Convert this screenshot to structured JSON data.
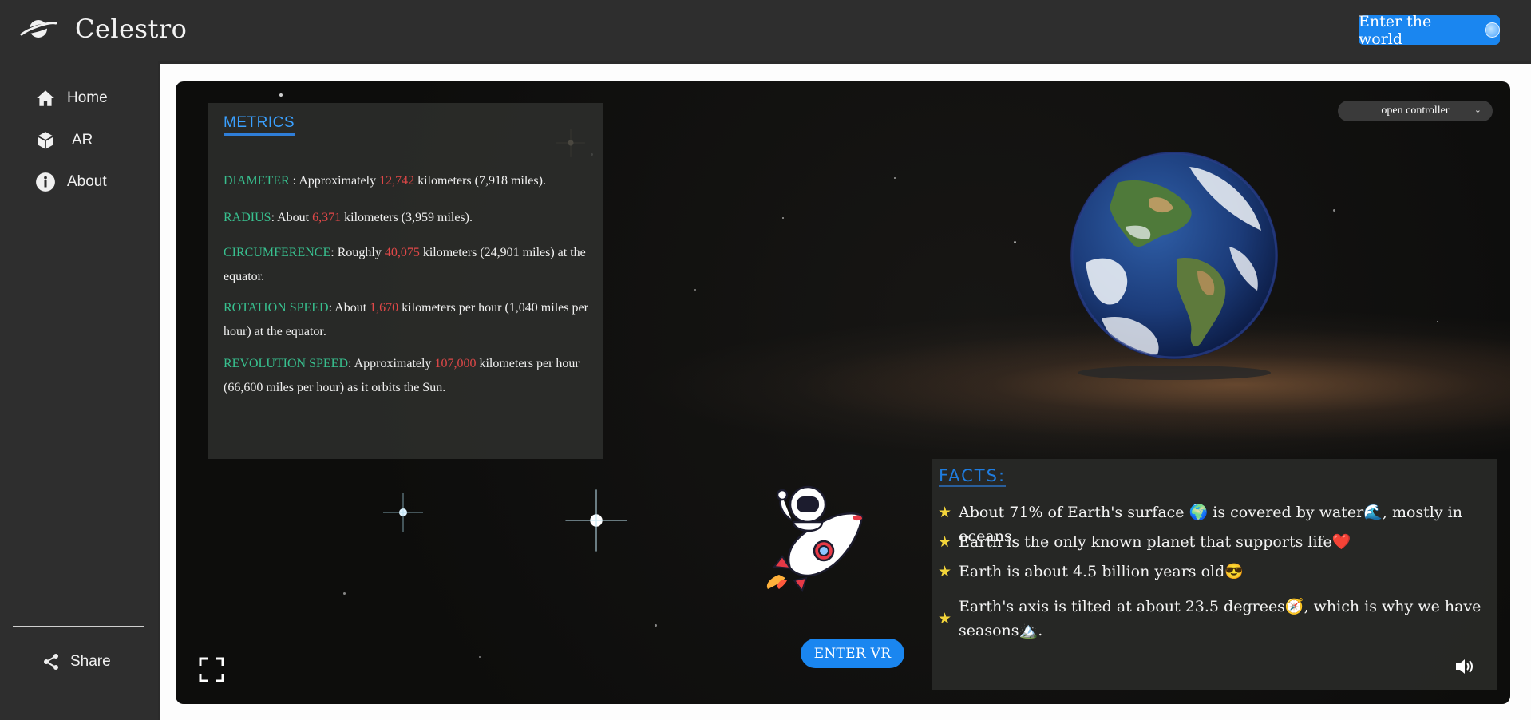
{
  "header": {
    "brand": "Celestro",
    "enter_world_label": "Enter the world"
  },
  "sidebar": {
    "items": [
      {
        "label": "Home",
        "icon": "home-icon"
      },
      {
        "label": "AR",
        "icon": "cube-icon"
      },
      {
        "label": "About",
        "icon": "info-icon"
      }
    ],
    "share_label": "Share"
  },
  "scene": {
    "controller_label": "open controller",
    "enter_vr_label": "ENTER VR"
  },
  "metrics": {
    "title": "METRICS",
    "rows": [
      {
        "key": "DIAMETER",
        "pre": " : Approximately ",
        "num": "12,742",
        "post": " kilometers (7,918 miles)."
      },
      {
        "key": "RADIUS",
        "pre": ": About ",
        "num": "6,371",
        "post": " kilometers (3,959 miles)."
      },
      {
        "key": "CIRCUMFERENCE",
        "pre": ": Roughly ",
        "num": "40,075",
        "post": " kilometers (24,901 miles) at the equator."
      },
      {
        "key": "ROTATION SPEED",
        "pre": ": About ",
        "num": "1,670",
        "post": " kilometers per hour (1,040 miles per hour) at the equator."
      },
      {
        "key": "REVOLUTION SPEED",
        "pre": ":  Approximately ",
        "num": "107,000",
        "post": " kilometers per hour (66,600 miles per hour) as it orbits the Sun."
      }
    ]
  },
  "facts": {
    "title": "FACTS:",
    "items": [
      "About 71% of Earth's surface 🌍 is covered by water🌊, mostly in oceans.",
      "Earth is the only known planet that supports life❤️",
      "Earth is about 4.5 billion years old😎",
      "Earth's axis is tilted at about 23.5 degrees🧭, which is why we have seasons🏔️."
    ]
  },
  "colors": {
    "accent": "#1a86f0",
    "metric_key": "#38c08f",
    "metric_number": "#e04848",
    "facts_title": "#1f7de0"
  }
}
